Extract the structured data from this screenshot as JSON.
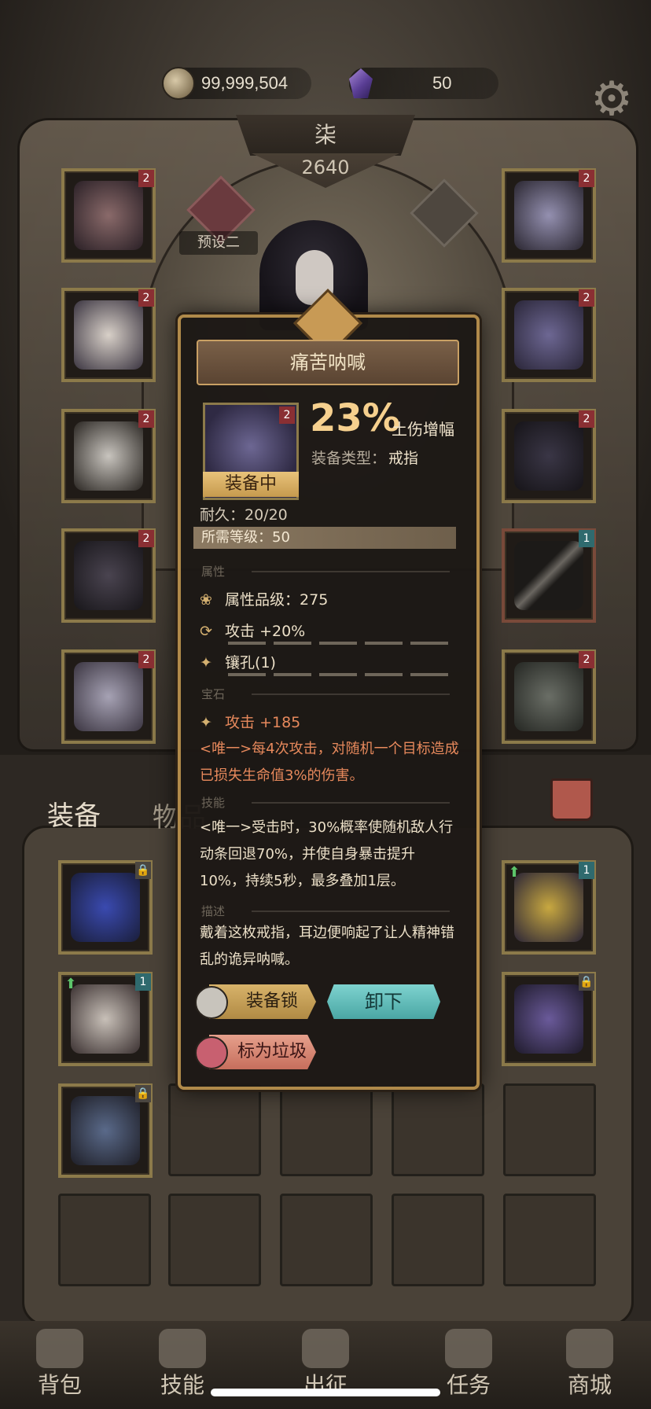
{
  "currency": {
    "coins": "99,999,504",
    "gems": "50"
  },
  "header": {
    "title": "柒",
    "power": "2640"
  },
  "preset": {
    "label": "预设二"
  },
  "tooltip": {
    "title": "痛苦呐喊",
    "badge": "2",
    "equipped_label": "装备中",
    "main_stat_value": "23%",
    "main_stat_label": "土伤增幅",
    "type_label": "装备类型：",
    "type_value": "戒指",
    "durability": "耐久：20/20",
    "required_level": "所需等级：50",
    "sections": {
      "attributes": "属性",
      "gems": "宝石",
      "skill": "技能",
      "description": "描述"
    },
    "attribute_grade": "属性品级：275",
    "attack_bonus": "攻击 +20%",
    "socket": "镶孔(1)",
    "gem_attack": "攻击 +185",
    "unique_effect_1": "<唯一>每4次攻击，对随机一个目标造成已损失生命值3%的伤害。",
    "skill_text": "<唯一>受击时，30%概率使随机敌人行动条回退70%，并使自身暴击提升10%，持续5秒，最多叠加1层。",
    "description_text": "戴着这枚戒指，耳边便响起了让人精神错乱的诡异呐喊。",
    "buttons": {
      "lock": "装备锁",
      "unequip": "卸下",
      "mark_junk": "标为垃圾"
    }
  },
  "equip_slots": {
    "left_badges": [
      "2",
      "2",
      "2",
      "2",
      "2"
    ],
    "right_badges": [
      "2",
      "2",
      "2",
      "1",
      "2"
    ]
  },
  "bag": {
    "tabs": {
      "equipment": "装备",
      "items": "物品"
    },
    "badges": [
      "1",
      "1"
    ]
  },
  "nav": {
    "bag": "背包",
    "skills": "技能",
    "expedition": "出征",
    "quests": "任务",
    "shop": "商城"
  },
  "colors": {
    "accent_gold": "#b08a4a",
    "unique_text": "#e7895c",
    "unequip_button": "#4aa6a4"
  }
}
